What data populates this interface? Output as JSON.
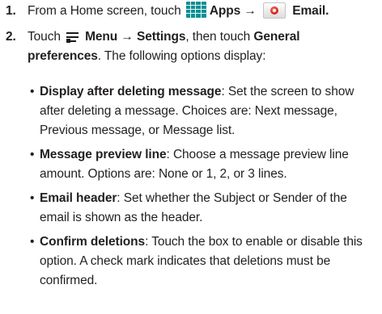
{
  "steps": [
    {
      "number": "1.",
      "text_a": "From a Home screen, touch",
      "apps_label": "Apps",
      "arrow": "→",
      "email_label": "Email",
      "end": "."
    },
    {
      "number": "2.",
      "text_a": "Touch",
      "menu_label": "Menu",
      "arrow": "→",
      "settings_label": "Settings",
      "text_b": ", then touch",
      "general_label": "General",
      "preferences_label": "preferences",
      "text_c": ". The following options display:"
    }
  ],
  "options": [
    {
      "term": "Display after deleting message",
      "description": ": Set the screen to show after deleting a message. Choices are: Next message, Previous message, or Message list."
    },
    {
      "term": "Message preview line",
      "description": ": Choose a message preview line amount. Options are: None or 1, 2, or 3 lines."
    },
    {
      "term": "Email header",
      "description": ": Set whether the Subject or Sender of the email is shown as the header."
    },
    {
      "term": "Confirm deletions",
      "description": ": Touch the box to enable or disable this option. A check mark indicates that deletions must be confirmed."
    }
  ],
  "bullet": "•",
  "icons": {
    "apps": "apps-grid-icon",
    "email": "email-app-icon",
    "menu": "menu-icon"
  },
  "colors": {
    "text": "#231f20",
    "apps_icon": "#0b8f94",
    "email_dot": "#d0211b"
  }
}
